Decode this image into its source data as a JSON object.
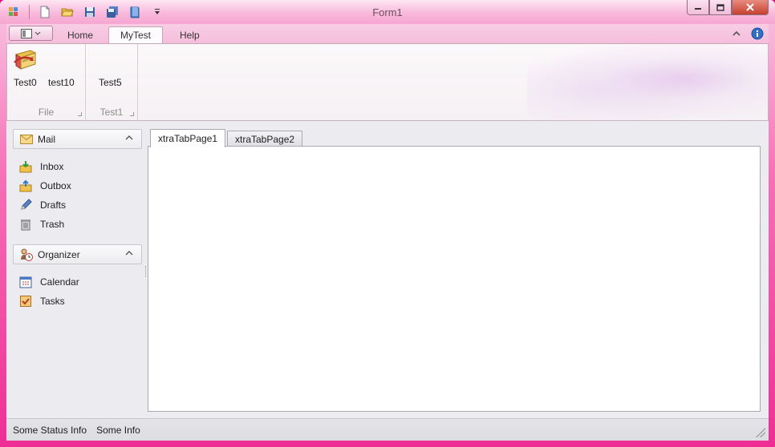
{
  "window": {
    "title": "Form1"
  },
  "qat": {
    "icons": [
      "app-menu-icon",
      "new-file-icon",
      "open-folder-icon",
      "save-icon",
      "save-all-icon",
      "book-icon",
      "customize-dropdown-icon"
    ]
  },
  "ribbon": {
    "tabs": [
      {
        "label": "Home"
      },
      {
        "label": "MyTest"
      },
      {
        "label": "Help"
      }
    ],
    "active_tab": "MyTest",
    "groups": [
      {
        "label": "File",
        "buttons": [
          {
            "label": "Test0"
          },
          {
            "label": "test10"
          }
        ]
      },
      {
        "label": "Test1",
        "buttons": [
          {
            "label": "Test5"
          }
        ]
      }
    ]
  },
  "nav": {
    "groups": [
      {
        "label": "Mail",
        "items": [
          {
            "label": "Inbox"
          },
          {
            "label": "Outbox"
          },
          {
            "label": "Drafts"
          },
          {
            "label": "Trash"
          }
        ]
      },
      {
        "label": "Organizer",
        "items": [
          {
            "label": "Calendar"
          },
          {
            "label": "Tasks"
          }
        ]
      }
    ]
  },
  "tabcontrol": {
    "tabs": [
      {
        "label": "xtraTabPage1"
      },
      {
        "label": "xtraTabPage2"
      }
    ],
    "active_index": 0
  },
  "status": {
    "items": [
      "Some Status Info",
      "Some Info"
    ]
  },
  "colors": {
    "frame": "#ee2e95",
    "titlebar": "#f9b9dc",
    "close_button": "#c6402d",
    "client_bg": "#ececf0"
  }
}
